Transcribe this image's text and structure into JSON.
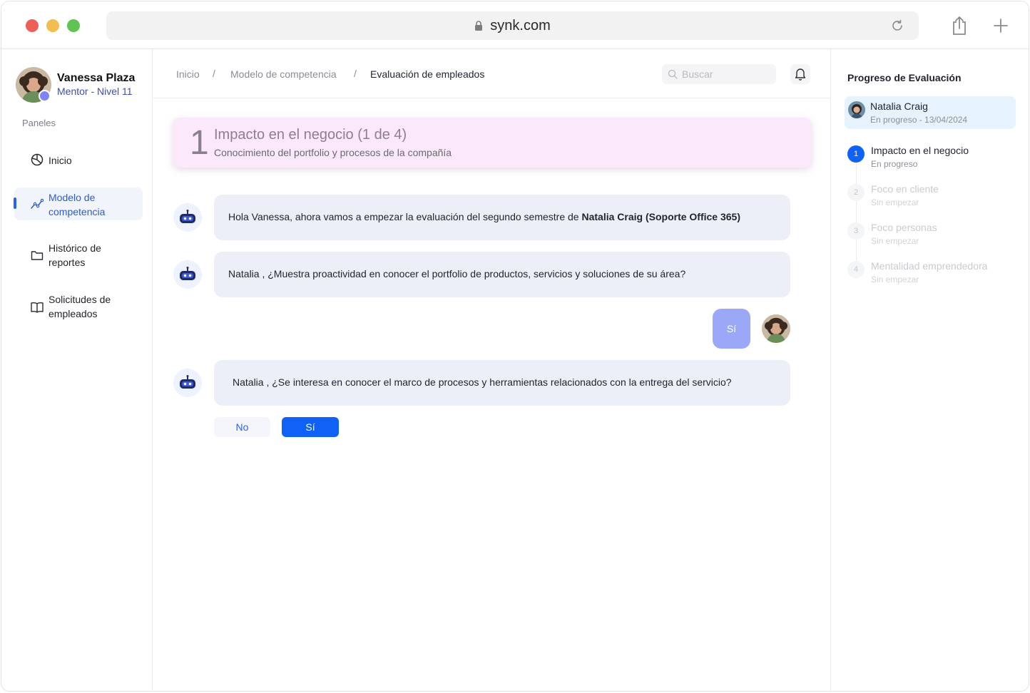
{
  "browser": {
    "url": "synk.com"
  },
  "profile": {
    "name": "Vanessa Plaza",
    "role": "Mentor - Nivel 11"
  },
  "sidebar": {
    "section_label": "Paneles",
    "items": [
      {
        "label": "Inicio",
        "icon": "chart-pie-icon",
        "active": false
      },
      {
        "label": "Modelo de competencia",
        "icon": "chart-line-icon",
        "active": true
      },
      {
        "label": "Histórico de reportes",
        "icon": "folder-icon",
        "active": false
      },
      {
        "label": "Solicitudes de empleados",
        "icon": "book-open-icon",
        "active": false
      }
    ]
  },
  "header": {
    "breadcrumb": [
      "Inicio",
      "Modelo de competencia",
      "Evaluación de empleados"
    ],
    "separator": "/",
    "search_placeholder": "Buscar"
  },
  "section": {
    "number": "1",
    "title": "Impacto en el negocio (1 de 4)",
    "subtitle": "Conocimiento del portfolio y procesos de la compañía"
  },
  "chat": {
    "messages": [
      {
        "from": "bot",
        "text_prefix": "Hola Vanessa, ahora vamos a empezar la evaluación del segundo semestre de ",
        "text_bold": "Natalia Craig (Soporte Office 365)"
      },
      {
        "from": "bot",
        "text": "Natalia , ¿Muestra proactividad en conocer el portfolio de productos, servicios y soluciones de su área?"
      },
      {
        "from": "user",
        "text": "Sí"
      },
      {
        "from": "bot",
        "text": "Natalia , ¿Se interesa en conocer el marco de procesos y herramientas relacionados con la entrega del servicio?"
      }
    ],
    "answer_options": [
      "No",
      "Sí"
    ]
  },
  "progress": {
    "title": "Progreso de Evaluación",
    "employee": {
      "name": "Natalia Craig",
      "status": "En progreso - 13/04/2024"
    },
    "steps": [
      {
        "number": "1",
        "name": "Impacto en el negocio",
        "status": "En progreso",
        "active": true
      },
      {
        "number": "2",
        "name": "Foco en cliente",
        "status": "Sin empezar",
        "active": false
      },
      {
        "number": "3",
        "name": "Foco personas",
        "status": "Sin empezar",
        "active": false
      },
      {
        "number": "4",
        "name": "Mentalidad emprendedora",
        "status": "Sin empezar",
        "active": false
      }
    ]
  },
  "colors": {
    "accent": "#0f62f5",
    "section_card": "#fbe9fb",
    "bubble": "#eceff7",
    "user_reply": "#9ba8f7"
  }
}
